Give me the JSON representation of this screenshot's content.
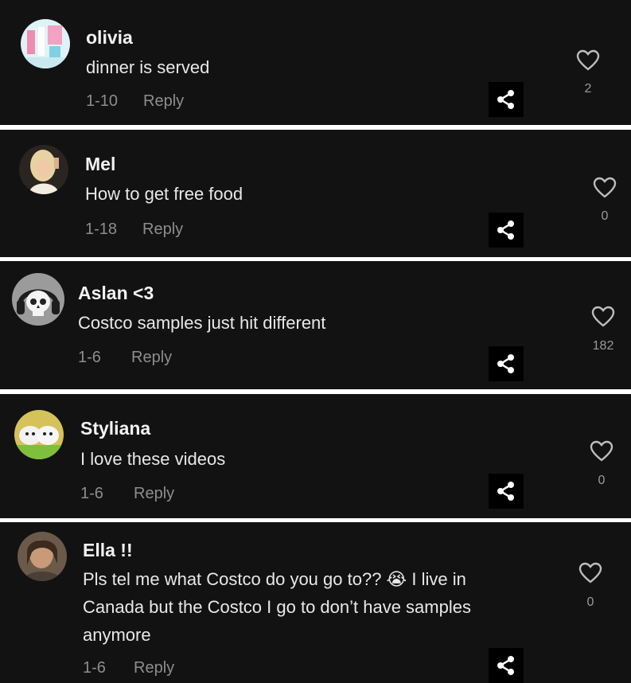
{
  "comments": [
    {
      "author": "olivia",
      "text": [
        "dinner is served"
      ],
      "date": "1-10",
      "reply": "Reply",
      "likes": "2",
      "avatar": "pink-room-avatar"
    },
    {
      "author": "Mel",
      "text": [
        "How to get free food"
      ],
      "date": "1-18",
      "reply": "Reply",
      "likes": "0",
      "avatar": "woman-portrait-avatar"
    },
    {
      "author": "Aslan <3",
      "text": [
        "Costco samples just hit different"
      ],
      "date": "1-6",
      "reply": "Reply",
      "likes": "182",
      "avatar": "skull-headphones-avatar"
    },
    {
      "author": "Styliana",
      "text": [
        "I love these videos"
      ],
      "date": "1-6",
      "reply": "Reply",
      "likes": "0",
      "avatar": "hamsters-avatar"
    },
    {
      "author": "Ella !!",
      "text": [
        "Pls tel me what Costco do you go to?? 😭  I live in",
        "Canada but the Costco I go to don’t have samples",
        "anymore"
      ],
      "date": "1-6",
      "reply": "Reply",
      "likes": "0",
      "avatar": "girl-photo-avatar"
    }
  ],
  "icons": {
    "share": "share-icon",
    "like": "heart-icon"
  }
}
